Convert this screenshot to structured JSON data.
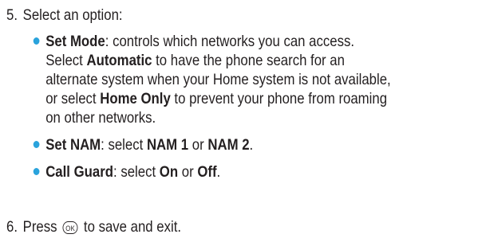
{
  "step5": {
    "number": "5.",
    "text": "Select an option:"
  },
  "options": [
    {
      "title": "Set Mode",
      "lines": [
        [
          {
            "t": ": controls which networks you can access."
          }
        ],
        [
          {
            "t": "Select "
          },
          {
            "b": "Automatic"
          },
          {
            "t": " to have the phone search for an"
          }
        ],
        [
          {
            "t": "alternate system when your Home system is not available,"
          }
        ],
        [
          {
            "t": "or select "
          },
          {
            "b": "Home Only"
          },
          {
            "t": " to prevent your phone from roaming"
          }
        ],
        [
          {
            "t": "on other networks."
          }
        ]
      ]
    },
    {
      "title": "Set NAM",
      "lines": [
        [
          {
            "t": ": select "
          },
          {
            "b": "NAM 1"
          },
          {
            "t": " or "
          },
          {
            "b": "NAM 2"
          },
          {
            "t": "."
          }
        ]
      ]
    },
    {
      "title": "Call Guard",
      "lines": [
        [
          {
            "t": ": select "
          },
          {
            "b": "On"
          },
          {
            "t": " or "
          },
          {
            "b": "Off"
          },
          {
            "t": "."
          }
        ]
      ]
    }
  ],
  "step6": {
    "number": "6.",
    "before": "Press",
    "icon_label": "OK",
    "icon": "ok-key-icon",
    "after": "to save and exit."
  },
  "colors": {
    "text": "#231f20",
    "bullet": "#2aa3dc"
  }
}
